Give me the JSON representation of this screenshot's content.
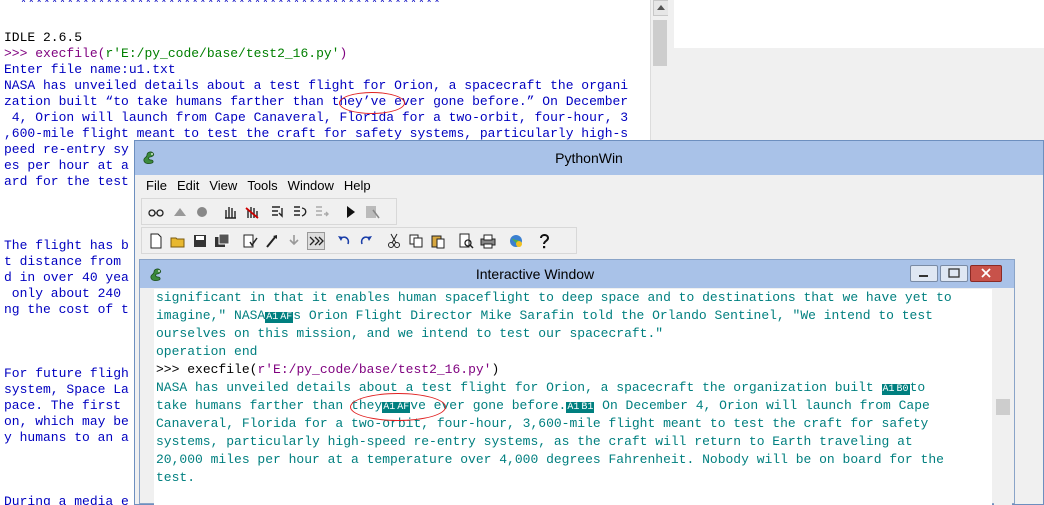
{
  "idle": {
    "stars": "  ******************************************************",
    "version": "IDLE 2.6.5",
    "prompt": ">>> ",
    "cmd_func": "execfile(",
    "cmd_arg": "r'E:/py_code/base/test2_16.py'",
    "cmd_close": ")",
    "input_prompt": "Enter file name:u1.txt",
    "lines": [
      "NASA has unveiled details about a test flight for Orion, a spacecraft the organi",
      "zation built “to take humans farther than they’ve ever gone before.” On December",
      " 4, Orion will launch from Cape Canaveral, Florida for a two-orbit, four-hour, 3",
      ",600-mile flight meant to test the craft for safety systems, particularly high-s",
      "peed re-entry sy",
      "es per hour at a",
      "ard for the test"
    ],
    "lines2": [
      "The flight has b",
      "t distance from",
      "d in over 40 yea",
      " only about 240",
      "ng the cost of t"
    ],
    "lines3": [
      "For future fligh",
      "system, Space La",
      "pace. The first",
      "on, which may be",
      "y humans to an a"
    ],
    "lines4": [
      "During a media e"
    ]
  },
  "pywin": {
    "title": "PythonWin",
    "menu": [
      "File",
      "Edit",
      "View",
      "Tools",
      "Window",
      "Help"
    ]
  },
  "interactive": {
    "title": "Interactive Window",
    "line1": "significant in that it enables human spaceflight to deep space and to destinations that we have yet to",
    "line2": "imagine,\" NASA",
    "line2_bad1": "A1",
    "line2_bad2": "AF",
    "line2_rest": "s Orion Flight Director Mike Sarafin told the Orlando Sentinel, \"We intend to test",
    "line3": "ourselves on this mission, and we intend to test our spacecraft.\"",
    "line4": "operation end",
    "prompt": ">>> ",
    "cmd_func": "execfile(",
    "cmd_arg": "r'E:/py_code/base/test2_16.py'",
    "cmd_close": ")",
    "line6": "NASA has unveiled details about a test flight for Orion, a spacecraft the organization built ",
    "line6_bad1": "A1",
    "line6_bad2": "B0",
    "line6_rest": "to",
    "line7a": "take humans farther than they",
    "line7_bad1": "A1",
    "line7_bad2": "AF",
    "line7b": "ve ever gone before.",
    "line7_bad3": "A1",
    "line7_bad4": "B1",
    "line7c": " On December 4, Orion will launch from Cape",
    "line8": "Canaveral, Florida for a two-orbit, four-hour, 3,600-mile flight meant to test the craft for safety",
    "line9": "systems, particularly high-speed re-entry systems, as the craft will return to Earth traveling at",
    "line10": "20,000 miles per hour at a temperature over 4,000 degrees Fahrenheit. Nobody will be on board for the",
    "line11": "test."
  },
  "colors": {
    "title_bar": "#a9c2e8",
    "output_text": "#007f7f",
    "string_text": "#7f007f",
    "annotation": "#e02020"
  }
}
